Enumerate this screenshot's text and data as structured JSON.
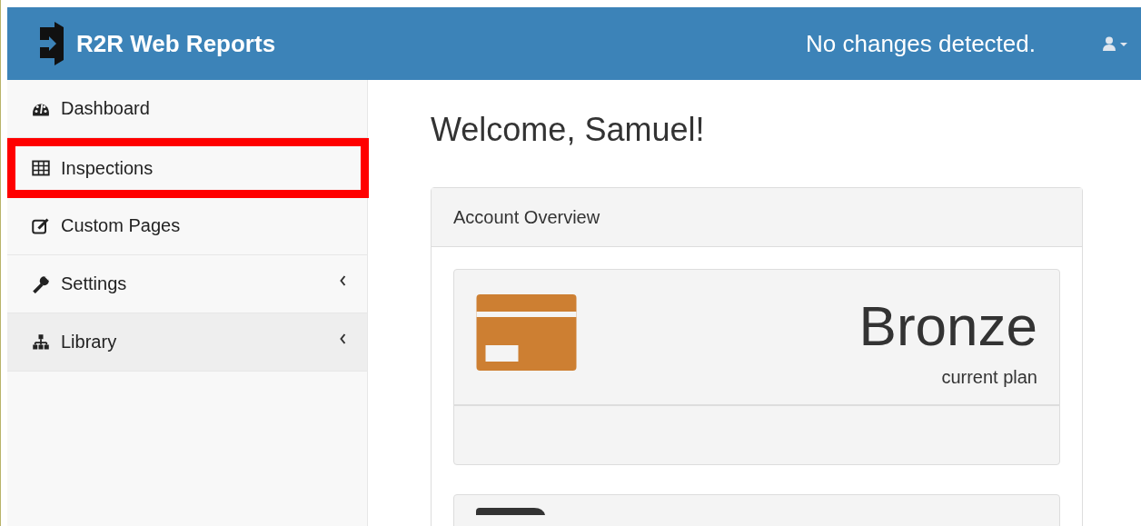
{
  "navbar": {
    "brand": "R2R Web Reports",
    "status": "No changes detected."
  },
  "sidebar": {
    "items": [
      {
        "label": "Dashboard",
        "kind": "dashboard",
        "has_submenu": false,
        "highlighted": false,
        "outlined": false
      },
      {
        "label": "Inspections",
        "kind": "table",
        "has_submenu": false,
        "highlighted": false,
        "outlined": true
      },
      {
        "label": "Custom Pages",
        "kind": "edit",
        "has_submenu": false,
        "highlighted": false,
        "outlined": false
      },
      {
        "label": "Settings",
        "kind": "wrench",
        "has_submenu": true,
        "highlighted": false,
        "outlined": false
      },
      {
        "label": "Library",
        "kind": "sitemap",
        "has_submenu": true,
        "highlighted": true,
        "outlined": false
      }
    ]
  },
  "content": {
    "heading": "Welcome, Samuel!",
    "panel": {
      "title": "Account Overview",
      "plan": {
        "name": "Bronze",
        "caption": "current plan"
      }
    }
  }
}
